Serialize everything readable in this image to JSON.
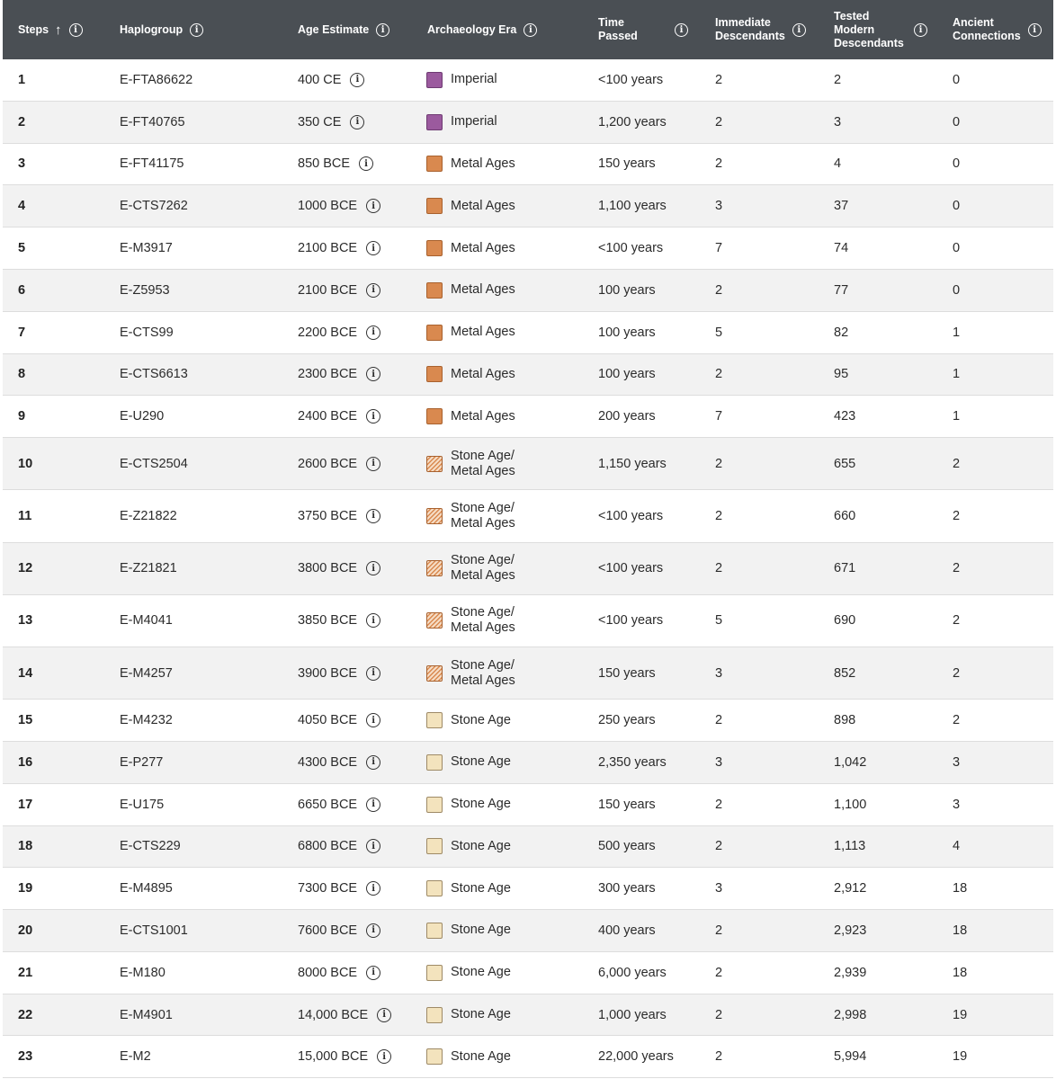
{
  "header": {
    "steps": "Steps",
    "haplogroup": "Haplogroup",
    "age_estimate": "Age Estimate",
    "archaeology_era": "Archaeology Era",
    "time_passed_1": "Time",
    "time_passed_2": "Passed",
    "immediate_1": "Immediate",
    "immediate_2": "Descendants",
    "tested_1": "Tested",
    "tested_2": "Modern",
    "tested_3": "Descendants",
    "ancient_1": "Ancient",
    "ancient_2": "Connections",
    "sort_icon": "arrow-up-icon",
    "info_icon": "info-icon"
  },
  "era_colors": {
    "Imperial": "#9b5a9e",
    "Metal Ages": "#d9894f",
    "Stone Age/Metal Ages": "hatched #d9894f",
    "Stone Age": "#f3e3bd"
  },
  "rows": [
    {
      "step": "1",
      "haplogroup": "E-FTA86622",
      "age": "400 CE",
      "era": "Imperial",
      "era_line1": "Imperial",
      "era_line2": "",
      "time": "<100 years",
      "immediate": "2",
      "tested": "2",
      "ancient": "0"
    },
    {
      "step": "2",
      "haplogroup": "E-FT40765",
      "age": "350 CE",
      "era": "Imperial",
      "era_line1": "Imperial",
      "era_line2": "",
      "time": "1,200 years",
      "immediate": "2",
      "tested": "3",
      "ancient": "0"
    },
    {
      "step": "3",
      "haplogroup": "E-FT41175",
      "age": "850 BCE",
      "era": "Metal Ages",
      "era_line1": "Metal Ages",
      "era_line2": "",
      "time": "150 years",
      "immediate": "2",
      "tested": "4",
      "ancient": "0"
    },
    {
      "step": "4",
      "haplogroup": "E-CTS7262",
      "age": "1000 BCE",
      "era": "Metal Ages",
      "era_line1": "Metal Ages",
      "era_line2": "",
      "time": "1,100 years",
      "immediate": "3",
      "tested": "37",
      "ancient": "0"
    },
    {
      "step": "5",
      "haplogroup": "E-M3917",
      "age": "2100 BCE",
      "era": "Metal Ages",
      "era_line1": "Metal Ages",
      "era_line2": "",
      "time": "<100 years",
      "immediate": "7",
      "tested": "74",
      "ancient": "0"
    },
    {
      "step": "6",
      "haplogroup": "E-Z5953",
      "age": "2100 BCE",
      "era": "Metal Ages",
      "era_line1": "Metal Ages",
      "era_line2": "",
      "time": "100 years",
      "immediate": "2",
      "tested": "77",
      "ancient": "0"
    },
    {
      "step": "7",
      "haplogroup": "E-CTS99",
      "age": "2200 BCE",
      "era": "Metal Ages",
      "era_line1": "Metal Ages",
      "era_line2": "",
      "time": "100 years",
      "immediate": "5",
      "tested": "82",
      "ancient": "1"
    },
    {
      "step": "8",
      "haplogroup": "E-CTS6613",
      "age": "2300 BCE",
      "era": "Metal Ages",
      "era_line1": "Metal Ages",
      "era_line2": "",
      "time": "100 years",
      "immediate": "2",
      "tested": "95",
      "ancient": "1"
    },
    {
      "step": "9",
      "haplogroup": "E-U290",
      "age": "2400 BCE",
      "era": "Metal Ages",
      "era_line1": "Metal Ages",
      "era_line2": "",
      "time": "200 years",
      "immediate": "7",
      "tested": "423",
      "ancient": "1"
    },
    {
      "step": "10",
      "haplogroup": "E-CTS2504",
      "age": "2600 BCE",
      "era": "Stone Age/Metal Ages",
      "era_line1": "Stone Age/",
      "era_line2": "Metal Ages",
      "time": "1,150 years",
      "immediate": "2",
      "tested": "655",
      "ancient": "2"
    },
    {
      "step": "11",
      "haplogroup": "E-Z21822",
      "age": "3750 BCE",
      "era": "Stone Age/Metal Ages",
      "era_line1": "Stone Age/",
      "era_line2": "Metal Ages",
      "time": "<100 years",
      "immediate": "2",
      "tested": "660",
      "ancient": "2"
    },
    {
      "step": "12",
      "haplogroup": "E-Z21821",
      "age": "3800 BCE",
      "era": "Stone Age/Metal Ages",
      "era_line1": "Stone Age/",
      "era_line2": "Metal Ages",
      "time": "<100 years",
      "immediate": "2",
      "tested": "671",
      "ancient": "2"
    },
    {
      "step": "13",
      "haplogroup": "E-M4041",
      "age": "3850 BCE",
      "era": "Stone Age/Metal Ages",
      "era_line1": "Stone Age/",
      "era_line2": "Metal Ages",
      "time": "<100 years",
      "immediate": "5",
      "tested": "690",
      "ancient": "2"
    },
    {
      "step": "14",
      "haplogroup": "E-M4257",
      "age": "3900 BCE",
      "era": "Stone Age/Metal Ages",
      "era_line1": "Stone Age/",
      "era_line2": "Metal Ages",
      "time": "150 years",
      "immediate": "3",
      "tested": "852",
      "ancient": "2"
    },
    {
      "step": "15",
      "haplogroup": "E-M4232",
      "age": "4050 BCE",
      "era": "Stone Age",
      "era_line1": "Stone Age",
      "era_line2": "",
      "time": "250 years",
      "immediate": "2",
      "tested": "898",
      "ancient": "2"
    },
    {
      "step": "16",
      "haplogroup": "E-P277",
      "age": "4300 BCE",
      "era": "Stone Age",
      "era_line1": "Stone Age",
      "era_line2": "",
      "time": "2,350 years",
      "immediate": "3",
      "tested": "1,042",
      "ancient": "3"
    },
    {
      "step": "17",
      "haplogroup": "E-U175",
      "age": "6650 BCE",
      "era": "Stone Age",
      "era_line1": "Stone Age",
      "era_line2": "",
      "time": "150 years",
      "immediate": "2",
      "tested": "1,100",
      "ancient": "3"
    },
    {
      "step": "18",
      "haplogroup": "E-CTS229",
      "age": "6800 BCE",
      "era": "Stone Age",
      "era_line1": "Stone Age",
      "era_line2": "",
      "time": "500 years",
      "immediate": "2",
      "tested": "1,113",
      "ancient": "4"
    },
    {
      "step": "19",
      "haplogroup": "E-M4895",
      "age": "7300 BCE",
      "era": "Stone Age",
      "era_line1": "Stone Age",
      "era_line2": "",
      "time": "300 years",
      "immediate": "3",
      "tested": "2,912",
      "ancient": "18"
    },
    {
      "step": "20",
      "haplogroup": "E-CTS1001",
      "age": "7600 BCE",
      "era": "Stone Age",
      "era_line1": "Stone Age",
      "era_line2": "",
      "time": "400 years",
      "immediate": "2",
      "tested": "2,923",
      "ancient": "18"
    },
    {
      "step": "21",
      "haplogroup": "E-M180",
      "age": "8000 BCE",
      "era": "Stone Age",
      "era_line1": "Stone Age",
      "era_line2": "",
      "time": "6,000 years",
      "immediate": "2",
      "tested": "2,939",
      "ancient": "18"
    },
    {
      "step": "22",
      "haplogroup": "E-M4901",
      "age": "14,000 BCE",
      "era": "Stone Age",
      "era_line1": "Stone Age",
      "era_line2": "",
      "time": "1,000 years",
      "immediate": "2",
      "tested": "2,998",
      "ancient": "19"
    },
    {
      "step": "23",
      "haplogroup": "E-M2",
      "age": "15,000 BCE",
      "era": "Stone Age",
      "era_line1": "Stone Age",
      "era_line2": "",
      "time": "22,000 years",
      "immediate": "2",
      "tested": "5,994",
      "ancient": "19"
    }
  ]
}
